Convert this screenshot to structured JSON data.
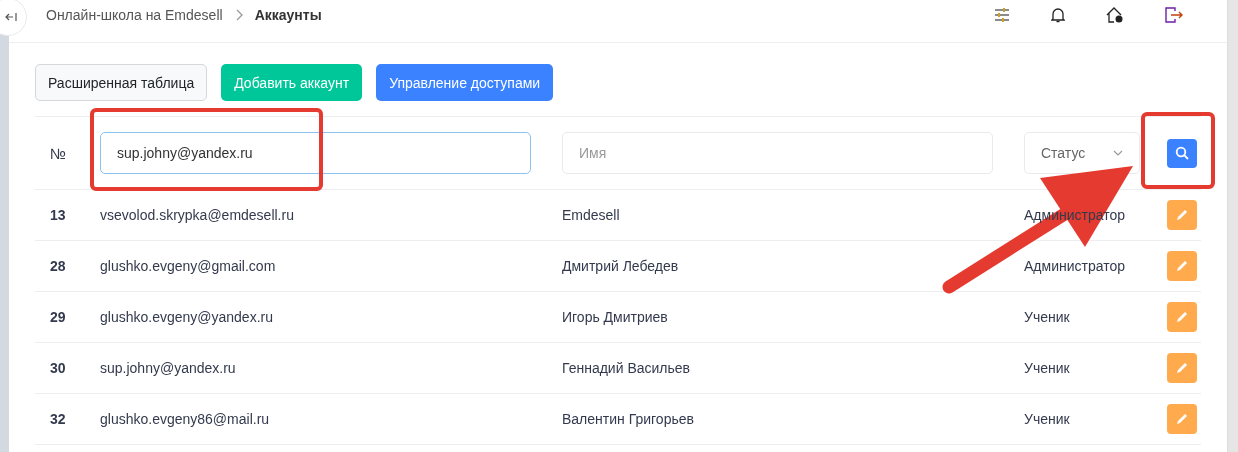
{
  "breadcrumb": [
    {
      "label": "Онлайн-школа на Emdesell",
      "current": false
    },
    {
      "label": "Аккаунты",
      "current": true
    }
  ],
  "toolbar": [
    {
      "label": "Расширенная таблица",
      "kind": "outline"
    },
    {
      "label": "Добавить аккаунт",
      "kind": "green"
    },
    {
      "label": "Управление доступами",
      "kind": "blue"
    }
  ],
  "filters": {
    "number_header": "№",
    "email": {
      "value": "sup.johny@yandex.ru",
      "focused": true
    },
    "name": {
      "placeholder": "Имя"
    },
    "status": {
      "placeholder": "Статус"
    }
  },
  "rows": [
    {
      "number": "13",
      "email": "vsevolod.skrypka@emdesell.ru",
      "name": "Emdesell",
      "status": "Администратор"
    },
    {
      "number": "28",
      "email": "glushko.evgeny@gmail.com",
      "name": "Дмитрий Лебедев",
      "status": "Администратор"
    },
    {
      "number": "29",
      "email": "glushko.evgeny@yandex.ru",
      "name": "Игорь Дмитриев",
      "status": "Ученик"
    },
    {
      "number": "30",
      "email": "sup.johny@yandex.ru",
      "name": "Геннадий Васильев",
      "status": "Ученик"
    },
    {
      "number": "32",
      "email": "glushko.evgeny86@mail.ru",
      "name": "Валентин Григорьев",
      "status": "Ученик"
    }
  ],
  "annotations": [
    {
      "kind": "frame"
    },
    {
      "kind": "frame"
    },
    {
      "kind": "arrow"
    }
  ]
}
